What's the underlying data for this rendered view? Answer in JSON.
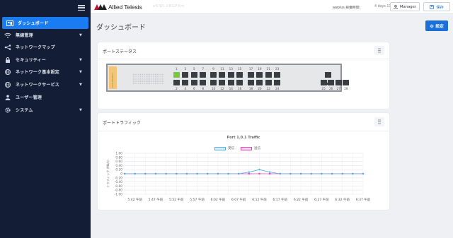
{
  "colors": {
    "sidebar_bg": "#131d35",
    "accent": "#1a7cf2",
    "link": "#1a6fd8",
    "port_up": "#7cc444",
    "port_down": "#3a3d41",
    "tx_series": "#4fb3e6",
    "rx_series": "#e048b9"
  },
  "sidebar": {
    "items": [
      {
        "label": "ダッシュボード",
        "icon": "dashboard-icon",
        "active": true,
        "has_caret": false
      },
      {
        "label": "無線管理",
        "icon": "wifi-icon",
        "active": false,
        "has_caret": true
      },
      {
        "label": "ネットワークマップ",
        "icon": "share-icon",
        "active": false,
        "has_caret": false
      },
      {
        "label": "セキュリティー",
        "icon": "lock-icon",
        "active": false,
        "has_caret": true
      },
      {
        "label": "ネットワーク基本設定",
        "icon": "network-icon",
        "active": false,
        "has_caret": true
      },
      {
        "label": "ネットワークサービス",
        "icon": "service-icon",
        "active": false,
        "has_caret": true
      },
      {
        "label": "ユーザー管理",
        "icon": "user-icon",
        "active": false,
        "has_caret": false
      },
      {
        "label": "システム",
        "icon": "gear-icon",
        "active": false,
        "has_caret": true
      }
    ]
  },
  "header": {
    "brand": "Allied Telesis",
    "device_name": "x530-28GPXm",
    "user_label": "awplus  稼働時間:",
    "uptime": "4 days 11:35",
    "manager_label": "Manager",
    "save_label": "保存"
  },
  "page": {
    "title": "ダッシュボード",
    "settings_label": "設定"
  },
  "port_status": {
    "title": "ポートステータス",
    "device_label": "x530-28GPXm",
    "top_labels": [
      "1",
      "3",
      "5",
      "7",
      "9",
      "11",
      "13",
      "15",
      "17",
      "19",
      "21",
      "23"
    ],
    "bottom_labels": [
      "2",
      "4",
      "6",
      "8",
      "10",
      "12",
      "14",
      "16",
      "18",
      "20",
      "22",
      "24"
    ],
    "sfp_labels": [
      "25",
      "26",
      "27",
      "28"
    ],
    "ports_up": [
      "1"
    ]
  },
  "port_traffic": {
    "title": "ポートトラフィック",
    "chart_data": {
      "type": "line",
      "title": "Port 1.0.1 Traffic",
      "ylabel": "トラフィック (Mb/s)",
      "xlabel": "",
      "ylim": [
        -1.0,
        1.0
      ],
      "yticks": [
        "1.00",
        "0.80",
        "0.60",
        "0.40",
        "0.20",
        "0",
        "-0.20",
        "-0.40",
        "-0.60",
        "-0.80",
        "-1.00"
      ],
      "x": [
        "5:40 午前",
        "5:42 午前",
        "5:45 午前",
        "5:47 午前",
        "5:50 午前",
        "5:52 午前",
        "5:55 午前",
        "5:57 午前",
        "6:00 午前",
        "6:02 午前",
        "6:05 午前",
        "6:07 午前",
        "6:10 午前",
        "6:12 午前",
        "6:15 午前",
        "6:17 午前",
        "6:20 午前",
        "6:22 午前",
        "6:25 午前",
        "6:27 午前",
        "6:30 午前",
        "6:32 午前",
        "6:35 午前",
        "6:37 午前"
      ],
      "xtick_labels": [
        "5:42 午前",
        "5:47 午前",
        "5:52 午前",
        "5:57 午前",
        "6:02 午前",
        "6:07 午前",
        "6:12 午前",
        "6:17 午前",
        "6:22 午前",
        "6:27 午前",
        "6:32 午前",
        "6:37 午前"
      ],
      "series": [
        {
          "name": "受信",
          "values": [
            0,
            0,
            0,
            0,
            0,
            0,
            0,
            0,
            0,
            0,
            0,
            0,
            0.08,
            0.2,
            0.08,
            0,
            0,
            0,
            0,
            0,
            0,
            0,
            0,
            0
          ]
        },
        {
          "name": "送信",
          "values": [
            0,
            0,
            0,
            0,
            0,
            0,
            0,
            0,
            0,
            0,
            0,
            0,
            0,
            0,
            0,
            0,
            0,
            0,
            0,
            0,
            0,
            0,
            0,
            0
          ]
        }
      ],
      "grid": true,
      "legend": "top-center"
    }
  }
}
